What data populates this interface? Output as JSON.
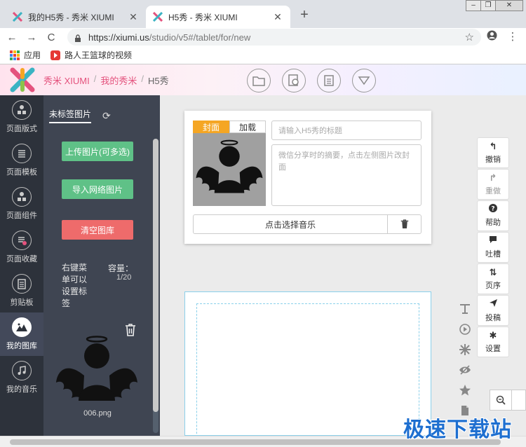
{
  "browser": {
    "tabs": [
      {
        "label": "我的H5秀 - 秀米 XIUMI",
        "active": false
      },
      {
        "label": "H5秀 - 秀米 XIUMI",
        "active": true
      }
    ],
    "url_host": "https://xiumi.us",
    "url_path": "/studio/v5#/tablet/for/new",
    "bookmarks": [
      {
        "label": "应用",
        "icon": "apps-grid-icon"
      },
      {
        "label": "路人王篮球的视频",
        "icon": "video-icon"
      }
    ]
  },
  "header": {
    "breadcrumb": [
      "秀米 XIUMI",
      "我的秀米",
      "H5秀"
    ],
    "tools": [
      "folder-icon",
      "camera-icon",
      "clipboard-icon",
      "dropdown-icon"
    ]
  },
  "sidebar": {
    "items": [
      {
        "label": "页面版式",
        "icon": "layout-icon",
        "active": false
      },
      {
        "label": "页面模板",
        "icon": "template-icon",
        "active": false
      },
      {
        "label": "页面组件",
        "icon": "component-icon",
        "active": false
      },
      {
        "label": "页面收藏",
        "icon": "favorite-icon",
        "active": false
      },
      {
        "label": "剪贴板",
        "icon": "clipboard-icon",
        "active": false
      },
      {
        "label": "我的图库",
        "icon": "image-icon",
        "active": true
      },
      {
        "label": "我的音乐",
        "icon": "music-icon",
        "active": false
      }
    ]
  },
  "panel": {
    "tab": "未标签图片",
    "upload_label": "上传图片(可多选)",
    "import_label": "导入网络图片",
    "clear_label": "清空图库",
    "hint": "右键菜单可以设置标签",
    "capacity_label": "容量：",
    "capacity_value": "1/20",
    "image_name": "006.png"
  },
  "card": {
    "tabs": [
      "封面",
      "加载"
    ],
    "title_placeholder": "请输入H5秀的标题",
    "summary_placeholder": "微信分享时的摘要，点击左侧图片改封面",
    "music_label": "点击选择音乐"
  },
  "right_panel": {
    "buttons": [
      {
        "label": "撤销",
        "icon": "undo-icon"
      },
      {
        "label": "重做",
        "icon": "redo-icon"
      },
      {
        "label": "帮助",
        "icon": "help-icon"
      },
      {
        "label": "吐槽",
        "icon": "comment-icon"
      },
      {
        "label": "页序",
        "icon": "sort-icon"
      },
      {
        "label": "投稿",
        "icon": "send-icon"
      },
      {
        "label": "设置",
        "icon": "gear-icon"
      }
    ]
  },
  "watermark": "极速下载站",
  "colors": {
    "accent": "#e4527d",
    "green_button": "#5fc187",
    "red_button": "#ee6b6b",
    "cover_tab": "#f5a623",
    "sidebar_bg": "#2d323b"
  }
}
